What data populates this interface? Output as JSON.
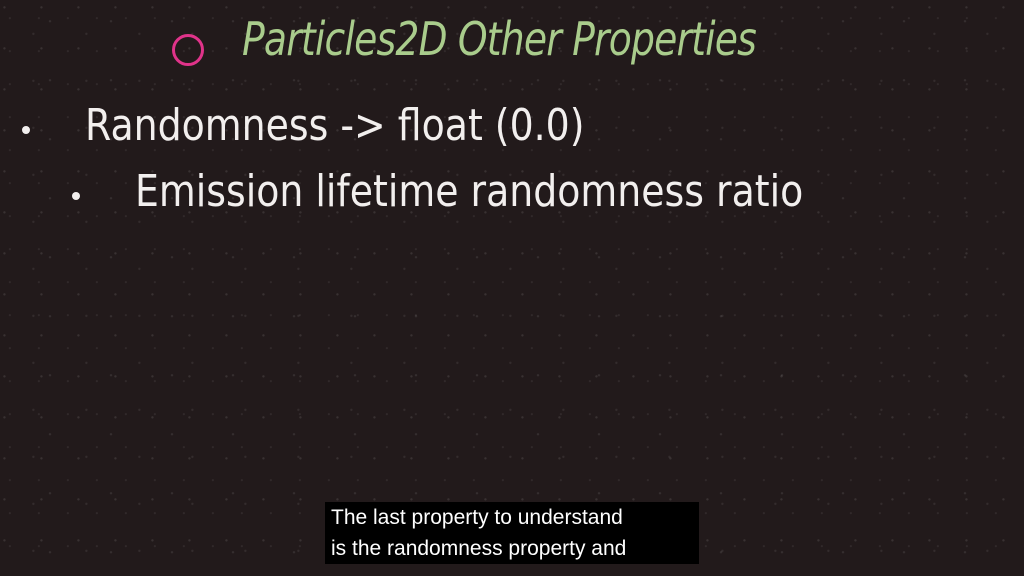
{
  "slide": {
    "title": "Particles2D Other Properties",
    "bullets": [
      {
        "text": "Randomness -> float (0.0)",
        "level": 1
      },
      {
        "text": "Emission lifetime randomness ratio",
        "level": 2
      }
    ]
  },
  "caption": {
    "lines": [
      "The last property to understand",
      "is the randomness property and"
    ]
  },
  "colors": {
    "background": "#221a1b",
    "title": "#a9cc8c",
    "title_circle": "#e0338a",
    "text": "#f2efee",
    "caption_bg": "#000000",
    "caption_text": "#ffffff"
  },
  "icons": {
    "title_marker": "circle-outline-icon",
    "bullet": "bullet-dot-icon"
  }
}
